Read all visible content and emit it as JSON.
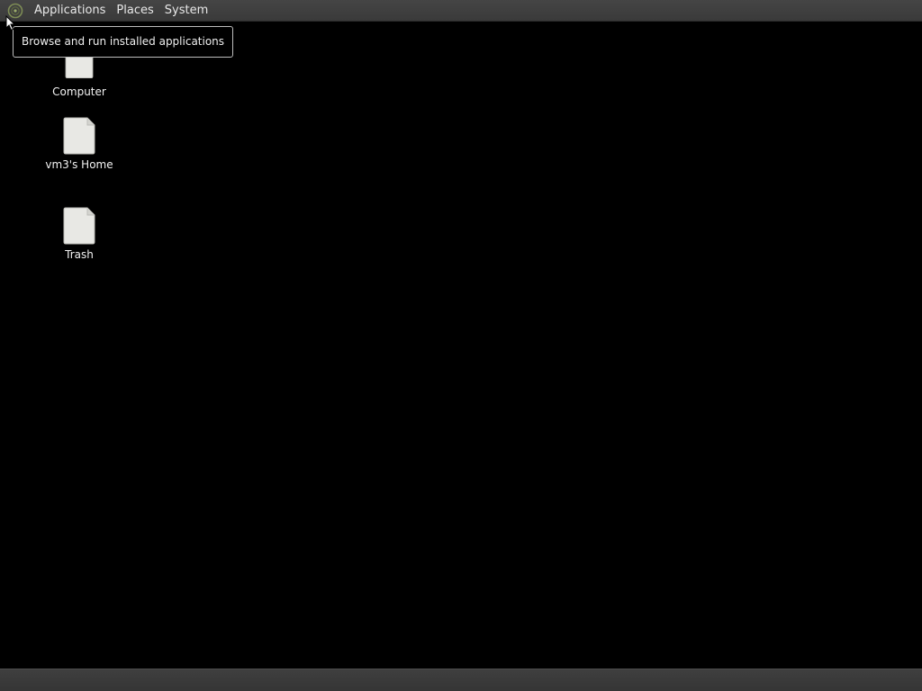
{
  "top_panel": {
    "logo_icon": "gnome-foot-icon",
    "menus": [
      {
        "label": "Applications"
      },
      {
        "label": "Places"
      },
      {
        "label": "System"
      }
    ]
  },
  "tooltip": {
    "text": "Browse and run installed applications"
  },
  "desktop_icons": [
    {
      "label": "Computer",
      "icon": "computer-icon"
    },
    {
      "label": "vm3's Home",
      "icon": "home-folder-icon"
    },
    {
      "label": "Trash",
      "icon": "trash-icon"
    }
  ],
  "colors": {
    "desktop_background": "#000000",
    "panel": "#3a3a3a",
    "icon_fill": "#e8e8e4",
    "logo_accent": "#8a9a5b"
  }
}
